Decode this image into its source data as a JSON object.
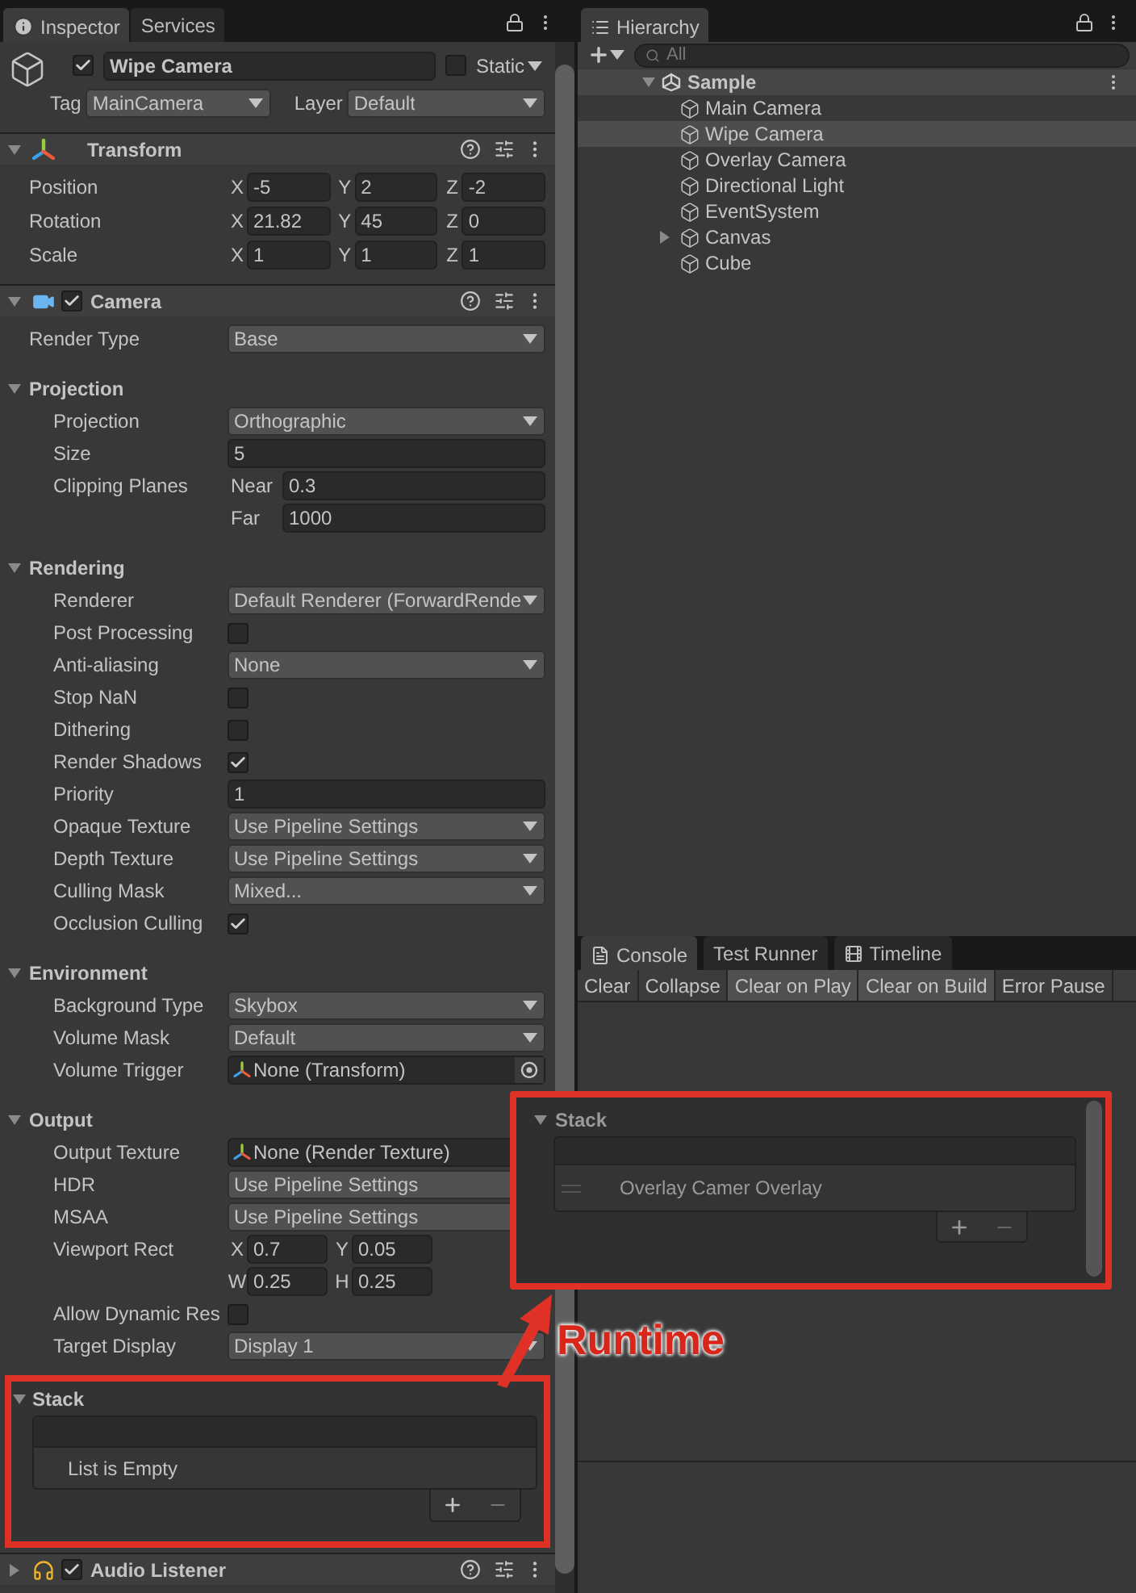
{
  "inspector_tabs": [
    {
      "label": "Inspector",
      "selected": true
    },
    {
      "label": "Services",
      "selected": false
    }
  ],
  "object": {
    "active": true,
    "name": "Wipe Camera",
    "static": false,
    "static_label": "Static",
    "tag_label": "Tag",
    "tag": "MainCamera",
    "layer_label": "Layer",
    "layer": "Default"
  },
  "transform": {
    "title": "Transform",
    "expanded": true,
    "rows": [
      {
        "kind": "vector",
        "label": "Position",
        "fields": [
          {
            "axis": "X",
            "value": "-5"
          },
          {
            "axis": "Y",
            "value": "2"
          },
          {
            "axis": "Z",
            "value": "-2"
          }
        ]
      },
      {
        "kind": "vector",
        "label": "Rotation",
        "fields": [
          {
            "axis": "X",
            "value": "21.82"
          },
          {
            "axis": "Y",
            "value": "45"
          },
          {
            "axis": "Z",
            "value": "0"
          }
        ]
      },
      {
        "kind": "vector",
        "label": "Scale",
        "fields": [
          {
            "axis": "X",
            "value": "1"
          },
          {
            "axis": "Y",
            "value": "1"
          },
          {
            "axis": "Z",
            "value": "1"
          }
        ]
      }
    ]
  },
  "camera": {
    "title": "Camera",
    "enabled": true,
    "expanded": true,
    "rows": [
      {
        "kind": "dropdown",
        "label": "Render Type",
        "value": "Base"
      },
      {
        "kind": "section",
        "label": "Projection",
        "expanded": true,
        "children": [
          {
            "kind": "dropdown",
            "label": "Projection",
            "value": "Orthographic"
          },
          {
            "kind": "field",
            "label": "Size",
            "value": "5"
          },
          {
            "kind": "subfield",
            "label": "Clipping Planes",
            "sublabel": "Near",
            "value": "0.3"
          },
          {
            "kind": "subfield",
            "sublabel": "Far",
            "value": "1000"
          }
        ]
      },
      {
        "kind": "section",
        "label": "Rendering",
        "expanded": true,
        "children": [
          {
            "kind": "dropdown",
            "label": "Renderer",
            "value": "Default Renderer (ForwardRende"
          },
          {
            "kind": "checkbox",
            "label": "Post Processing",
            "checked": false
          },
          {
            "kind": "dropdown",
            "label": "Anti-aliasing",
            "value": "None"
          },
          {
            "kind": "checkbox",
            "label": "Stop NaN",
            "checked": false
          },
          {
            "kind": "checkbox",
            "label": "Dithering",
            "checked": false
          },
          {
            "kind": "checkbox",
            "label": "Render Shadows",
            "checked": true
          },
          {
            "kind": "field",
            "label": "Priority",
            "value": "1"
          },
          {
            "kind": "dropdown",
            "label": "Opaque Texture",
            "value": "Use Pipeline Settings"
          },
          {
            "kind": "dropdown",
            "label": "Depth Texture",
            "value": "Use Pipeline Settings"
          },
          {
            "kind": "dropdown",
            "label": "Culling Mask",
            "value": "Mixed..."
          },
          {
            "kind": "checkbox",
            "label": "Occlusion Culling",
            "checked": true
          }
        ]
      },
      {
        "kind": "section",
        "label": "Environment",
        "expanded": true,
        "children": [
          {
            "kind": "dropdown",
            "label": "Background Type",
            "value": "Skybox"
          },
          {
            "kind": "dropdown",
            "label": "Volume Mask",
            "value": "Default"
          },
          {
            "kind": "object",
            "label": "Volume Trigger",
            "value": "None (Transform)"
          }
        ]
      },
      {
        "kind": "section",
        "label": "Output",
        "expanded": true,
        "children": [
          {
            "kind": "object",
            "label": "Output Texture",
            "value": "None (Render Texture)"
          },
          {
            "kind": "dropdown",
            "label": "HDR",
            "value": "Use Pipeline Settings"
          },
          {
            "kind": "dropdown",
            "label": "MSAA",
            "value": "Use Pipeline Settings"
          },
          {
            "kind": "vector",
            "label": "Viewport Rect",
            "fields": [
              {
                "axis": "X",
                "value": "0.7"
              },
              {
                "axis": "Y",
                "value": "0.05"
              }
            ]
          },
          {
            "kind": "vector",
            "fields": [
              {
                "axis": "W",
                "value": "0.25"
              },
              {
                "axis": "H",
                "value": "0.25"
              }
            ]
          },
          {
            "kind": "checkbox",
            "label": "Allow Dynamic Res",
            "checked": false
          },
          {
            "kind": "dropdown",
            "label": "Target Display",
            "value": "Display 1"
          }
        ]
      }
    ]
  },
  "stack": {
    "title": "Stack",
    "expanded": true,
    "empty_text": "List is Empty"
  },
  "audio_listener": {
    "title": "Audio Listener",
    "enabled": true
  },
  "hierarchy": {
    "tab": "Hierarchy",
    "search_placeholder": "All",
    "scene": {
      "name": "Sample",
      "expanded": true,
      "children": [
        {
          "name": "Main Camera",
          "selected": false,
          "expandable": false
        },
        {
          "name": "Wipe Camera",
          "selected": true,
          "expandable": false
        },
        {
          "name": "Overlay Camera",
          "selected": false,
          "expandable": false
        },
        {
          "name": "Directional Light",
          "selected": false,
          "expandable": false
        },
        {
          "name": "EventSystem",
          "selected": false,
          "expandable": false
        },
        {
          "name": "Canvas",
          "selected": false,
          "expandable": true
        },
        {
          "name": "Cube",
          "selected": false,
          "expandable": false
        }
      ]
    }
  },
  "console_tabs": [
    {
      "label": "Console",
      "selected": true
    },
    {
      "label": "Test Runner",
      "selected": false
    },
    {
      "label": "Timeline",
      "selected": false
    }
  ],
  "console_toolbar": [
    {
      "label": "Clear",
      "on": false
    },
    {
      "label": "Collapse",
      "on": false
    },
    {
      "label": "Clear on Play",
      "on": true
    },
    {
      "label": "Clear on Build",
      "on": true
    },
    {
      "label": "Error Pause",
      "on": false
    }
  ],
  "runtime_callout": {
    "title": "Stack",
    "items": [
      "Overlay Camer Overlay"
    ],
    "label": "Runtime"
  }
}
